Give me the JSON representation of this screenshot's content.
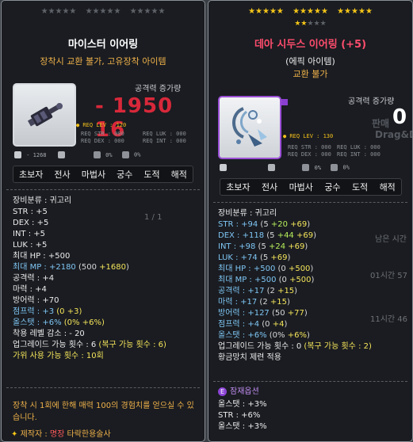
{
  "left": {
    "stars_row": [
      "★★★★★",
      "★★★★★",
      "★★★★★"
    ],
    "title": "마이스터 이어링",
    "trade_note": "장착시 교환 불가, 고유장착 아이템",
    "atk_label": "공격력 증가량",
    "atk_value": "- 1950 16",
    "req_lev": "● REQ LEV : 120",
    "req_str": "REQ STR : 000",
    "req_luk": "REQ LUK : 000",
    "req_dex": "REQ DEX : 000",
    "req_int": "REQ INT : 000",
    "mini_stat1": "- 1268",
    "mini_stat2": "0%",
    "mini_stat3": "0%",
    "jobs": [
      "초보자",
      "전사",
      "마법사",
      "궁수",
      "도적",
      "해적"
    ],
    "stats": {
      "category": "장비분류 : 귀고리",
      "str": "STR : +5",
      "dex": "DEX : +5",
      "int": "INT : +5",
      "luk": "LUK : +5",
      "hp": "최대 HP : +500",
      "mp_label": "최대 MP : +2180",
      "mp_paren_open": " (500 ",
      "mp_bonus": "+1680",
      "mp_paren_close": ")",
      "atk": "공격력 : +4",
      "matk": "마력 : +4",
      "def": "방어력 : +70",
      "jump_label": "점프력 : +3",
      "jump_paren": " (0 +3)",
      "allstat_label": "올스탯 : +6%",
      "allstat_paren": " (0% +6%)",
      "level_reduce": "착용 레벨 감소 : - 20",
      "upgrade": "업그레이드 가능 횟수 : 6",
      "upgrade_paren": " (복구 가능 횟수 : 6)",
      "scissors": "가위 사용 가능 횟수 : 10회"
    },
    "desc": "장착 시 1회에 한해 매력 100의 경험치를 얻으실 수 있습니다.",
    "maker_label": "제작자 : ",
    "maker_rank": "명장",
    "maker_name": " 타락한용술사",
    "bg_page": "1 / 1"
  },
  "right": {
    "stars_row": [
      "★★★★★",
      "★★★★★",
      "★★★★★"
    ],
    "stars_row2": "★★★★★ ★★★★★",
    "title": "데아 시두스 이어링 (+5)",
    "grade": "(에픽 아이템)",
    "trade_note": "교환 불가",
    "atk_label": "공격력 증가량",
    "atk_value": "0",
    "bg_sell": "판매",
    "bg_drag": "Drag&Dro",
    "req_lev": "● REQ LEV : 130",
    "req_str": "REQ STR : 000",
    "req_luk": "REQ LUK : 000",
    "req_dex": "REQ DEX : 000",
    "req_int": "REQ INT : 000",
    "mini_stat2": "0%",
    "mini_stat3": "0%",
    "jobs": [
      "초보자",
      "전사",
      "마법사",
      "궁수",
      "도적",
      "해적"
    ],
    "stats": {
      "category": "장비분류 : 귀고리",
      "str": [
        "STR : +94",
        " (5 ",
        "+20",
        " +69",
        ")"
      ],
      "dex": [
        "DEX : +118",
        " (5 ",
        "+44",
        " +69",
        ")"
      ],
      "int": [
        "INT : +98",
        " (5 ",
        "+24",
        " +69",
        ")"
      ],
      "luk": [
        "LUK : +74",
        " (5 ",
        "+69",
        ")"
      ],
      "hp": [
        "최대 HP : +500",
        " (0 ",
        "+500",
        ")"
      ],
      "mp": [
        "최대 MP : +500",
        " (0 ",
        "+500",
        ")"
      ],
      "atk": [
        "공격력 : +17",
        " (2 ",
        "+15",
        ")"
      ],
      "matk": [
        "마력 : +17",
        " (2 ",
        "+15",
        ")"
      ],
      "def": [
        "방어력 : +127",
        " (50 ",
        "+77",
        ")"
      ],
      "jump": [
        "점프력 : +4",
        " (0 ",
        "+4",
        ")"
      ],
      "allstat": [
        "올스탯 : +6%",
        " (0% ",
        "+6%",
        ")"
      ],
      "upgrade": "업그레이드 가능 횟수 : 0",
      "upgrade_paren": " (복구 가능 횟수 : 2)",
      "hammer": "황금망치 제련 적용"
    },
    "potential_icon": "E",
    "potential_title": "잠재옵션",
    "potential": [
      "올스탯 : +3%",
      "STR : +6%",
      "올스탯 : +3%"
    ],
    "bg_remaining": "남은 시간",
    "bg_time1": "01시간 57",
    "bg_time2": "11시간 46"
  },
  "colors": {
    "atk_negative": "#d8283a",
    "stat_blue": "#7fc6f4",
    "bonus_green": "#b8f05a",
    "bonus_yellow": "#f4e45a",
    "desc_orange": "#f0b24a",
    "epic_purple": "#8c44d6",
    "star_gold": "#f5c518"
  }
}
